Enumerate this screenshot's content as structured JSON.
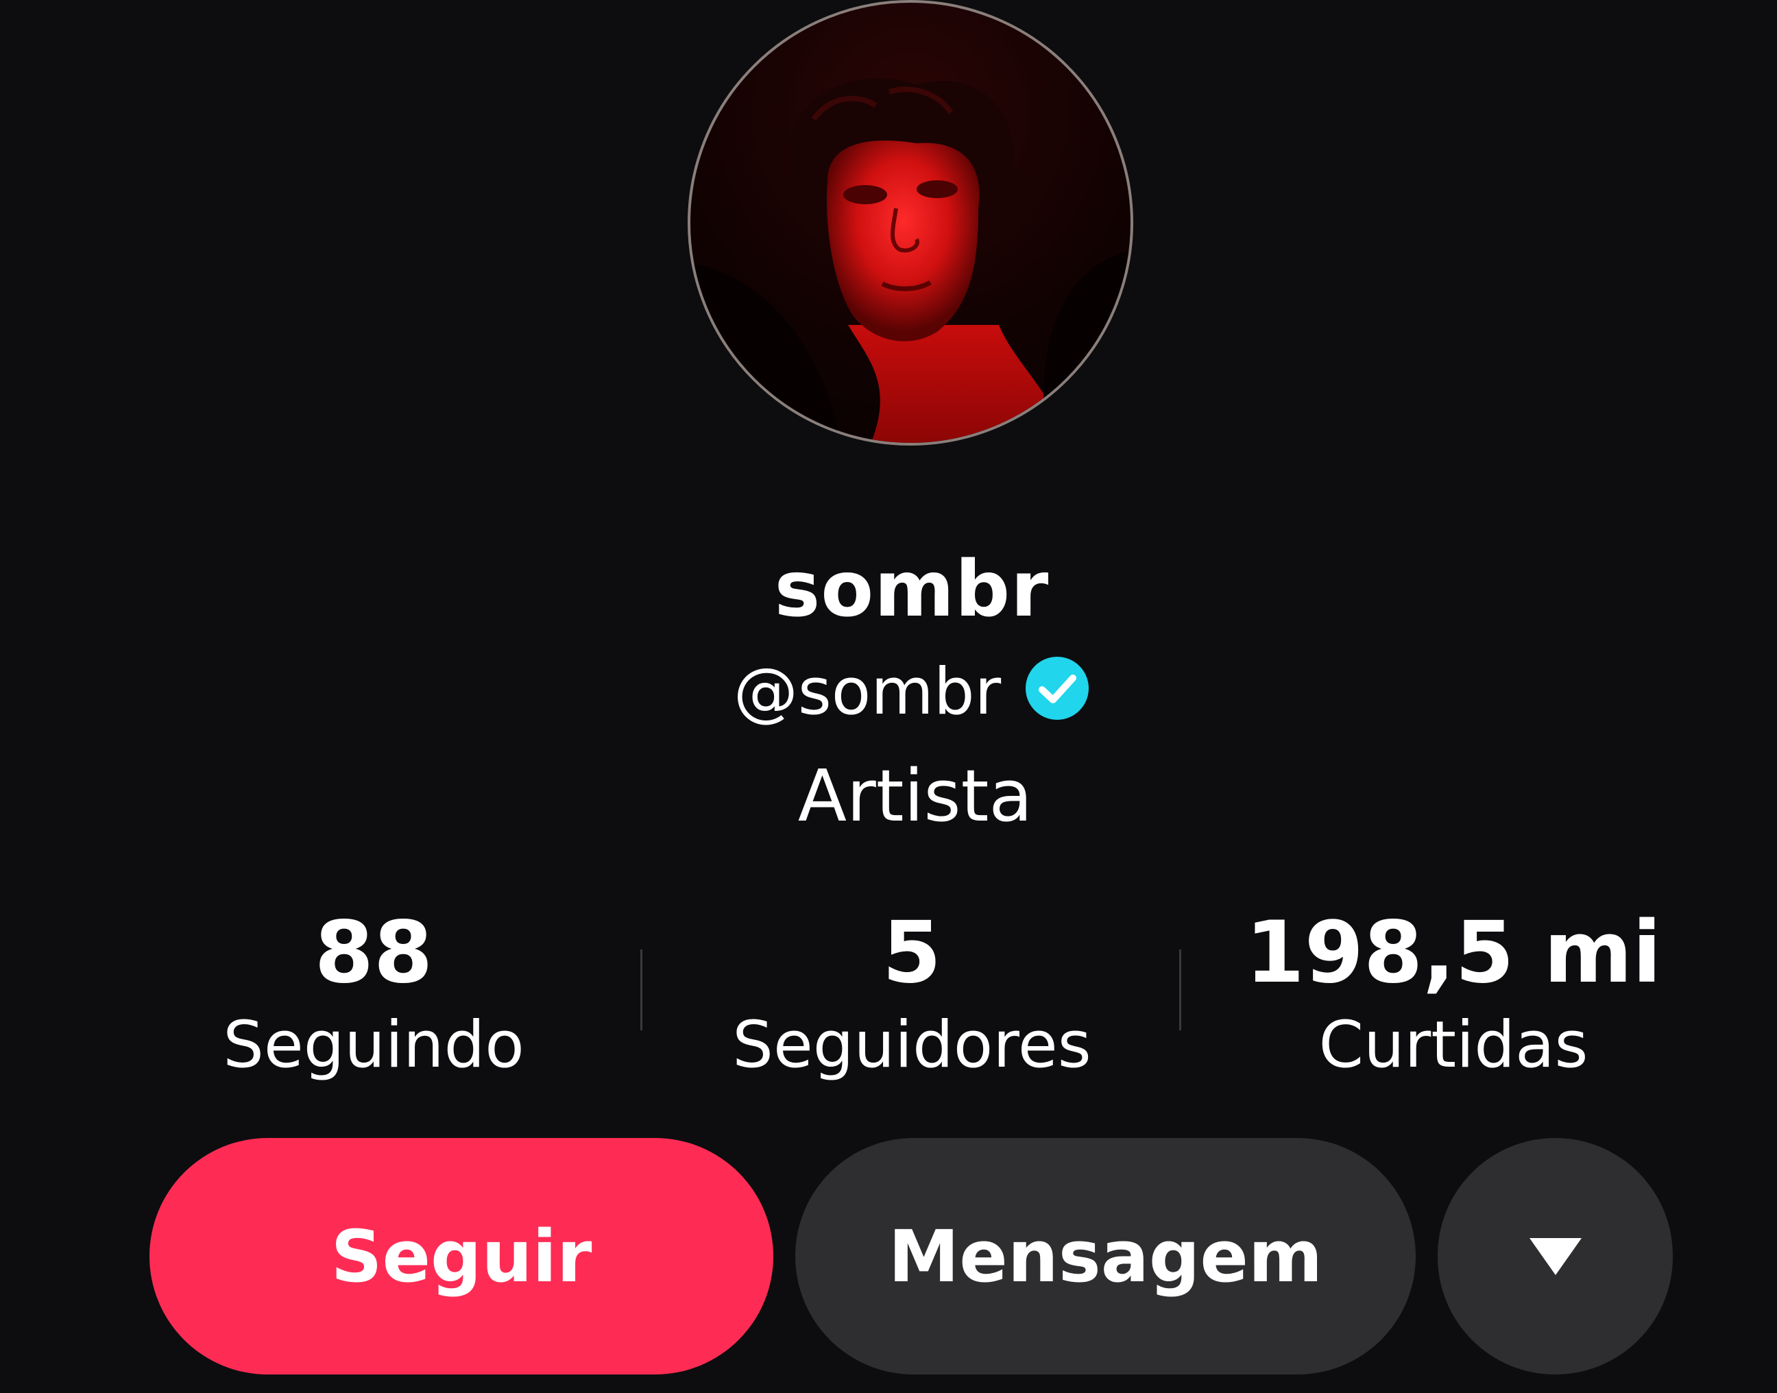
{
  "profile": {
    "display_name": "sombr",
    "handle": "@sombr",
    "verified_icon": "verified-badge-icon",
    "category": "Artista"
  },
  "stats": [
    {
      "value": "88",
      "label": "Seguindo"
    },
    {
      "value": "5",
      "label": "Seguidores"
    },
    {
      "value": "198,5 mi",
      "label": "Curtidas"
    }
  ],
  "actions": {
    "follow_label": "Seguir",
    "message_label": "Mensagem",
    "more_icon": "triangle-down-icon"
  },
  "colors": {
    "background": "#0d0d0f",
    "follow_button": "#fe2c55",
    "secondary_button": "#2e2e30",
    "verified": "#20d5ec"
  }
}
